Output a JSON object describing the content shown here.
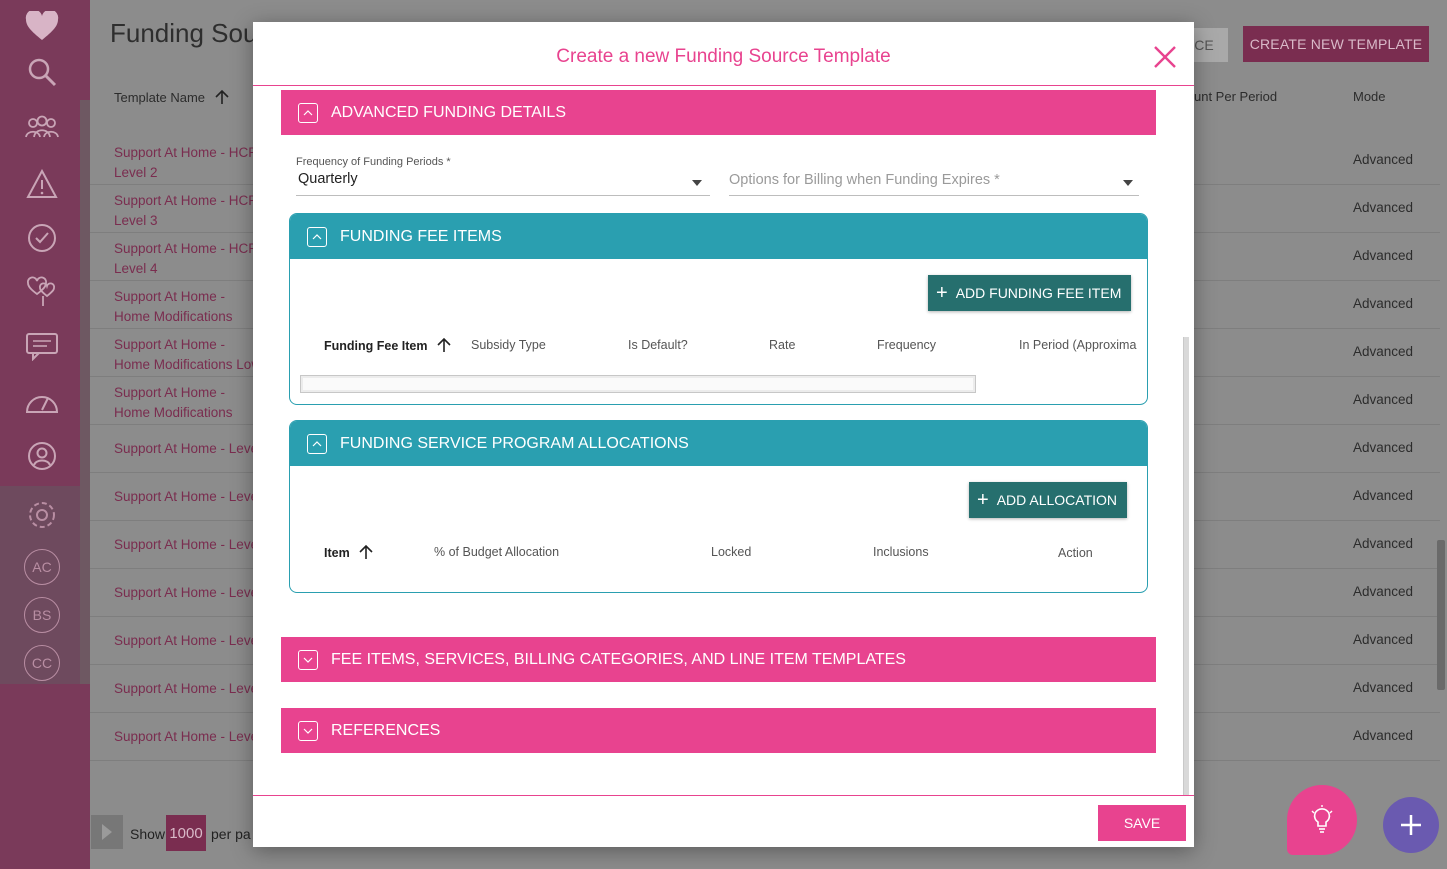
{
  "background": {
    "page_title": "Funding Sour",
    "button_ce_label": "CE",
    "button_create_label": "CREATE NEW TEMPLATE",
    "headers": {
      "template_name": "Template Name",
      "amount_per_period": "unt Per Period",
      "mode": "Mode"
    },
    "rows": [
      {
        "name": "Support At Home - HCP Level 2",
        "mode": "Advanced"
      },
      {
        "name": "Support At Home - HCP Level 3",
        "mode": "Advanced"
      },
      {
        "name": "Support At Home - HCP Level 4",
        "mode": "Advanced"
      },
      {
        "name": "Support At Home - Home Modifications High",
        "mode": "Advanced"
      },
      {
        "name": "Support At Home - Home Modifications Low",
        "mode": "Advanced"
      },
      {
        "name": "Support At Home - Home Modifications Medium",
        "mode": "Advanced"
      },
      {
        "name": "Support At Home - Leve",
        "mode": "Advanced"
      },
      {
        "name": "Support At Home - Leve",
        "mode": "Advanced"
      },
      {
        "name": "Support At Home - Leve",
        "mode": "Advanced"
      },
      {
        "name": "Support At Home - Leve",
        "mode": "Advanced"
      },
      {
        "name": "Support At Home - Leve",
        "mode": "Advanced"
      },
      {
        "name": "Support At Home - Leve",
        "mode": "Advanced"
      },
      {
        "name": "Support At Home - Leve",
        "mode": "Advanced"
      }
    ],
    "footer": {
      "show": "Show",
      "per_page_value": "1000",
      "per_page": "per pa"
    },
    "sidebar_initials": [
      "AC",
      "BS",
      "CC"
    ]
  },
  "modal": {
    "title": "Create a new Funding Source Template",
    "sections": {
      "advanced": "ADVANCED FUNDING DETAILS",
      "fee_items_services": "FEE ITEMS, SERVICES, BILLING CATEGORIES, AND LINE ITEM TEMPLATES",
      "references": "REFERENCES"
    },
    "frequency_field": {
      "label": "Frequency of Funding Periods *",
      "value": "Quarterly"
    },
    "billing_field": {
      "placeholder": "Options for Billing when Funding Expires *"
    },
    "funding_fee_items": {
      "title": "FUNDING FEE ITEMS",
      "add_button": "ADD FUNDING FEE ITEM",
      "columns": [
        "Funding Fee Item",
        "Subsidy Type",
        "Is Default?",
        "Rate",
        "Frequency",
        "In Period (Approxima"
      ]
    },
    "allocations": {
      "title": "FUNDING SERVICE PROGRAM ALLOCATIONS",
      "add_button": "ADD ALLOCATION",
      "columns": [
        "Item",
        "% of Budget Allocation",
        "Locked",
        "Inclusions",
        "Action"
      ]
    },
    "save_label": "SAVE"
  },
  "colors": {
    "brand_pink": "#e8438f",
    "teal": "#2a9fb0",
    "teal_button": "#266f6e",
    "fab_purple": "#6a5ab0"
  }
}
